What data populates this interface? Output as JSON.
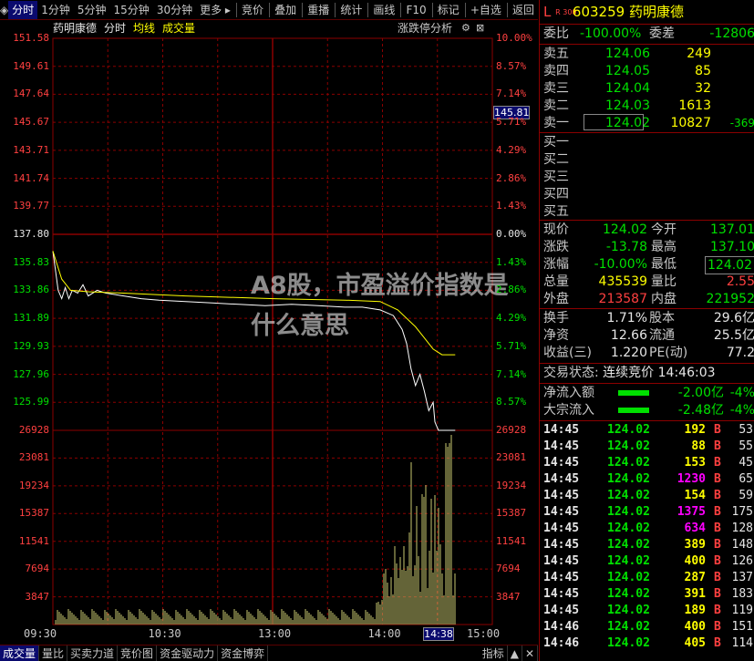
{
  "toolbar": {
    "items": [
      "分时",
      "1分钟",
      "5分钟",
      "15分钟",
      "30分钟",
      "更多",
      "竞价",
      "叠加",
      "重播",
      "统计",
      "画线",
      "F10",
      "标记",
      "+自选",
      "返回"
    ],
    "active": "分时"
  },
  "chart": {
    "header_name": "药明康德",
    "header_period": "分时",
    "header_avg": "均线",
    "header_volume": "成交量",
    "header_right": "涨跌停分析",
    "price_labels": [
      "151.58",
      "149.61",
      "147.64",
      "145.67",
      "143.71",
      "141.74",
      "139.77",
      "137.80",
      "135.83",
      "133.86",
      "131.89",
      "129.93",
      "127.96",
      "125.99"
    ],
    "pct_labels": [
      "10.00%",
      "8.57%",
      "7.14%",
      "5.71%",
      "4.29%",
      "2.86%",
      "1.43%",
      "0.00%",
      "1.43%",
      "2.86%",
      "4.29%",
      "5.71%",
      "7.14%",
      "8.57%"
    ],
    "vol_labels": [
      "26928",
      "23081",
      "19234",
      "15387",
      "11541",
      "7694",
      "3847"
    ],
    "time_labels": [
      "09:30",
      "10:30",
      "13:00",
      "14:00",
      "15:00"
    ],
    "cursor_time": "14:38",
    "cursor_price": "145.81",
    "watermark": "A8股，市盈溢价指数是什么意思"
  },
  "bottom_tabs": [
    "成交量",
    "量比",
    "买卖力道",
    "竞价图",
    "资金驱动力",
    "资金博弈"
  ],
  "bottom_right": "指标",
  "panel": {
    "flag": "L",
    "flag2": "R 300",
    "code": "603259",
    "name": "药明康德",
    "weibi_label": "委比",
    "weibi": "-100.00%",
    "weicha_label": "委差",
    "weicha": "-12806",
    "asks": [
      {
        "label": "卖五",
        "price": "124.06",
        "vol": "249",
        "chg": ""
      },
      {
        "label": "卖四",
        "price": "124.05",
        "vol": "85",
        "chg": ""
      },
      {
        "label": "卖三",
        "price": "124.04",
        "vol": "32",
        "chg": ""
      },
      {
        "label": "卖二",
        "price": "124.03",
        "vol": "1613",
        "chg": ""
      },
      {
        "label": "卖一",
        "price": "124.02",
        "vol": "10827",
        "chg": "-369"
      }
    ],
    "bids": [
      "买一",
      "买二",
      "买三",
      "买四",
      "买五"
    ],
    "quote": [
      {
        "l1": "现价",
        "v1": "124.02",
        "l2": "今开",
        "v2": "137.01"
      },
      {
        "l1": "涨跌",
        "v1": "-13.78",
        "l2": "最高",
        "v2": "137.10"
      },
      {
        "l1": "涨幅",
        "v1": "-10.00%",
        "l2": "最低",
        "v2": "124.02"
      },
      {
        "l1": "总量",
        "v1": "435539",
        "l2": "量比",
        "v2": "2.55"
      },
      {
        "l1": "外盘",
        "v1": "213587",
        "l2": "内盘",
        "v2": "221952"
      }
    ],
    "stats": [
      {
        "l1": "换手",
        "v1": "1.71%",
        "l2": "股本",
        "v2": "29.6亿"
      },
      {
        "l1": "净资",
        "v1": "12.66",
        "l2": "流通",
        "v2": "25.5亿"
      },
      {
        "l1": "收益(三)",
        "v1": "1.220",
        "l2": "PE(动)",
        "v2": "77.2"
      }
    ],
    "trade_status_label": "交易状态:",
    "trade_status": "连续竞价",
    "trade_time": "14:46:03",
    "flows": [
      {
        "label": "净流入额",
        "value": "-2.00亿",
        "pct": "-4%"
      },
      {
        "label": "大宗流入",
        "value": "-2.48亿",
        "pct": "-4%"
      }
    ],
    "ticks": [
      {
        "t": "14:45",
        "p": "124.02",
        "v": "192",
        "d": "B",
        "n": "53"
      },
      {
        "t": "14:45",
        "p": "124.02",
        "v": "88",
        "d": "B",
        "n": "55"
      },
      {
        "t": "14:45",
        "p": "124.02",
        "v": "153",
        "d": "B",
        "n": "45"
      },
      {
        "t": "14:45",
        "p": "124.02",
        "v": "1230",
        "d": "B",
        "n": "65"
      },
      {
        "t": "14:45",
        "p": "124.02",
        "v": "154",
        "d": "B",
        "n": "59"
      },
      {
        "t": "14:45",
        "p": "124.02",
        "v": "1375",
        "d": "B",
        "n": "175"
      },
      {
        "t": "14:45",
        "p": "124.02",
        "v": "634",
        "d": "B",
        "n": "128"
      },
      {
        "t": "14:45",
        "p": "124.02",
        "v": "389",
        "d": "B",
        "n": "148"
      },
      {
        "t": "14:45",
        "p": "124.02",
        "v": "400",
        "d": "B",
        "n": "126"
      },
      {
        "t": "14:45",
        "p": "124.02",
        "v": "287",
        "d": "B",
        "n": "137"
      },
      {
        "t": "14:45",
        "p": "124.02",
        "v": "391",
        "d": "B",
        "n": "183"
      },
      {
        "t": "14:45",
        "p": "124.02",
        "v": "189",
        "d": "B",
        "n": "119"
      },
      {
        "t": "14:46",
        "p": "124.02",
        "v": "400",
        "d": "B",
        "n": "151"
      },
      {
        "t": "14:46",
        "p": "124.02",
        "v": "405",
        "d": "B",
        "n": "114"
      }
    ],
    "colors": {
      "up": "#ff4040",
      "down": "#00e000",
      "grid": "#8b0000",
      "highlight": "#ff00ff"
    }
  }
}
